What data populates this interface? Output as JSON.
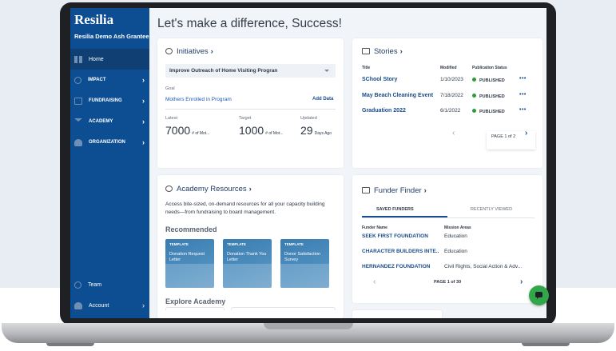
{
  "app": {
    "brand": "Resilia",
    "org_name": "Resilia Demo Ash Grantee",
    "greeting": "Let's make a difference, Success!"
  },
  "sidebar": {
    "items": [
      {
        "label": "Home",
        "icon": "home-grid-icon"
      },
      {
        "label": "IMPACT",
        "icon": "impact-icon"
      },
      {
        "label": "FUNDRAISING",
        "icon": "fundraising-icon"
      },
      {
        "label": "ACADEMY",
        "icon": "academy-cap-icon"
      },
      {
        "label": "ORGANIZATION",
        "icon": "organization-icon"
      }
    ],
    "bottom": [
      {
        "label": "Team",
        "icon": "team-icon"
      },
      {
        "label": "Account",
        "icon": "account-gear-icon"
      }
    ],
    "chevron": "›"
  },
  "initiatives": {
    "title": "Initiatives",
    "selected": "Improve Outreach of Home Visiting Progran",
    "goal_label": "Goal",
    "goal": "Mothers Enrolled in Program",
    "add_data": "Add Data",
    "latest_label": "Latest",
    "target_label": "Target",
    "updated_label": "Updated",
    "latest_value": "7000",
    "latest_unit": "# of Mot...",
    "target_value": "1000",
    "target_unit": "# of Mot...",
    "updated_value": "29",
    "updated_unit": "Days Ago"
  },
  "stories": {
    "title": "Stories",
    "headers": {
      "title": "Title",
      "modified": "Modified",
      "status": "Publication Status"
    },
    "rows": [
      {
        "title": "SChool Story",
        "date": "1/10/2023",
        "status": "PUBLISHED"
      },
      {
        "title": "May Beach Cleaning Event",
        "date": "7/18/2022",
        "status": "PUBLISHED"
      },
      {
        "title": "Graduation 2022",
        "date": "6/1/2022",
        "status": "PUBLISHED"
      }
    ],
    "more": "•••",
    "page": "PAGE 1 of 2",
    "prev": "‹",
    "next": "›"
  },
  "academy": {
    "title": "Academy Resources",
    "description": "Access bite-sized, on-demand resources for all your capacity building needs—from fundraising to board management.",
    "recommended": "Recommended",
    "tag": "TEMPLATE",
    "templates": [
      "Donation Request Letter",
      "Donation Thank You Letter",
      "Donor Satisfaction Survey"
    ],
    "explore": "Explore Academy"
  },
  "funder": {
    "title": "Funder Finder",
    "tab_saved": "SAVED FUNDERS",
    "tab_recent": "RECENTLY VIEWED",
    "col_name": "Funder Name",
    "col_areas": "Mission Areas",
    "rows": [
      {
        "name": "SEEK FIRST FOUNDATION",
        "areas": "Education"
      },
      {
        "name": "CHARACTER BUILDERS INTE..",
        "areas": "Education"
      },
      {
        "name": "HERNANDEZ FOUNDATION",
        "areas": "Civil Rights, Social Action & Adv..."
      }
    ],
    "page": "PAGE 1 of 30",
    "prev": "‹",
    "next": "›"
  },
  "colors": {
    "sidebar": "#0d4e93",
    "link": "#1b4c8c",
    "published": "#2f9b3c",
    "chat": "#32a64a"
  }
}
